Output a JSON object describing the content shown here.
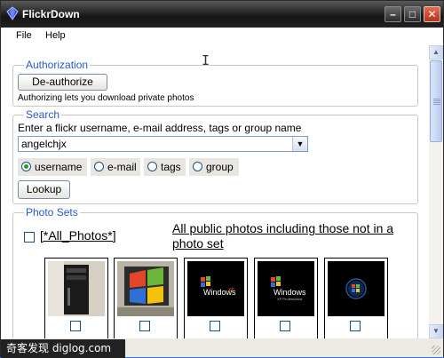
{
  "window": {
    "title": "FlickrDown"
  },
  "titlebar_buttons": {
    "minimize": "–",
    "maximize": "□",
    "close": "✕"
  },
  "menu": {
    "items": [
      "File",
      "Help"
    ]
  },
  "authorization": {
    "legend": "Authorization",
    "button_label": "De-authorize",
    "note": "Authorizing lets you download private photos"
  },
  "search": {
    "legend": "Search",
    "prompt": "Enter a flickr username, e-mail address, tags or group name",
    "value": "angelchjx",
    "options": [
      {
        "label": "username",
        "selected": true
      },
      {
        "label": "e-mail",
        "selected": false
      },
      {
        "label": "tags",
        "selected": false
      },
      {
        "label": "group",
        "selected": false
      }
    ],
    "lookup_label": "Lookup"
  },
  "photo_sets": {
    "legend": "Photo Sets",
    "all_photos_label": "[*All_Photos*]",
    "public_link": "All public photos including those not in a photo set",
    "thumbnails": [
      {
        "subject": "computer-tower",
        "checked": false
      },
      {
        "subject": "windows-flag-monitor",
        "checked": false
      },
      {
        "subject": "windows-xp-splash",
        "logo_text": "Windows",
        "edition": "XP",
        "checked": false
      },
      {
        "subject": "windows-xp-splash-professional",
        "logo_text": "Windows",
        "edition": "XP Professional",
        "checked": false
      },
      {
        "subject": "windows-orb",
        "checked": false
      }
    ]
  },
  "watermark": "奇客发现 diglog.com",
  "colors": {
    "legend": "#2a59c8",
    "titlebar": "#222222",
    "radio_dot": "#24a024"
  }
}
